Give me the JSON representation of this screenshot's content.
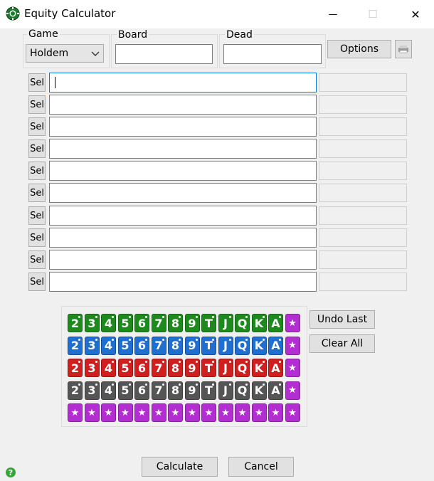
{
  "window": {
    "title": "Equity Calculator",
    "minimize_glyph": "—",
    "maximize_glyph": "☐",
    "close_glyph": "✕"
  },
  "game": {
    "label": "Game",
    "selected": "Holdem",
    "arrow": "⌄"
  },
  "board": {
    "label": "Board",
    "value": ""
  },
  "dead": {
    "label": "Dead",
    "value": ""
  },
  "options_label": "Options",
  "sel_label": "Sel",
  "hands": [
    {
      "range": "",
      "equity": ""
    },
    {
      "range": "",
      "equity": ""
    },
    {
      "range": "",
      "equity": ""
    },
    {
      "range": "",
      "equity": ""
    },
    {
      "range": "",
      "equity": ""
    },
    {
      "range": "",
      "equity": ""
    },
    {
      "range": "",
      "equity": ""
    },
    {
      "range": "",
      "equity": ""
    },
    {
      "range": "",
      "equity": ""
    },
    {
      "range": "",
      "equity": ""
    }
  ],
  "card_ranks": [
    "2",
    "3",
    "4",
    "5",
    "6",
    "7",
    "8",
    "9",
    "T",
    "J",
    "Q",
    "K",
    "A"
  ],
  "wildcard_glyph": "★",
  "suit_colors": [
    "#1e8a1e",
    "#1f6fd0",
    "#d01f1f",
    "#555555"
  ],
  "wildcard_color": "#b22ed1",
  "undo_label": "Undo Last",
  "clear_label": "Clear All",
  "calculate_label": "Calculate",
  "cancel_label": "Cancel",
  "help_glyph": "?",
  "icons": {
    "app": "poker-chip-icon",
    "help": "help-icon",
    "options_side": "printer-icon"
  }
}
